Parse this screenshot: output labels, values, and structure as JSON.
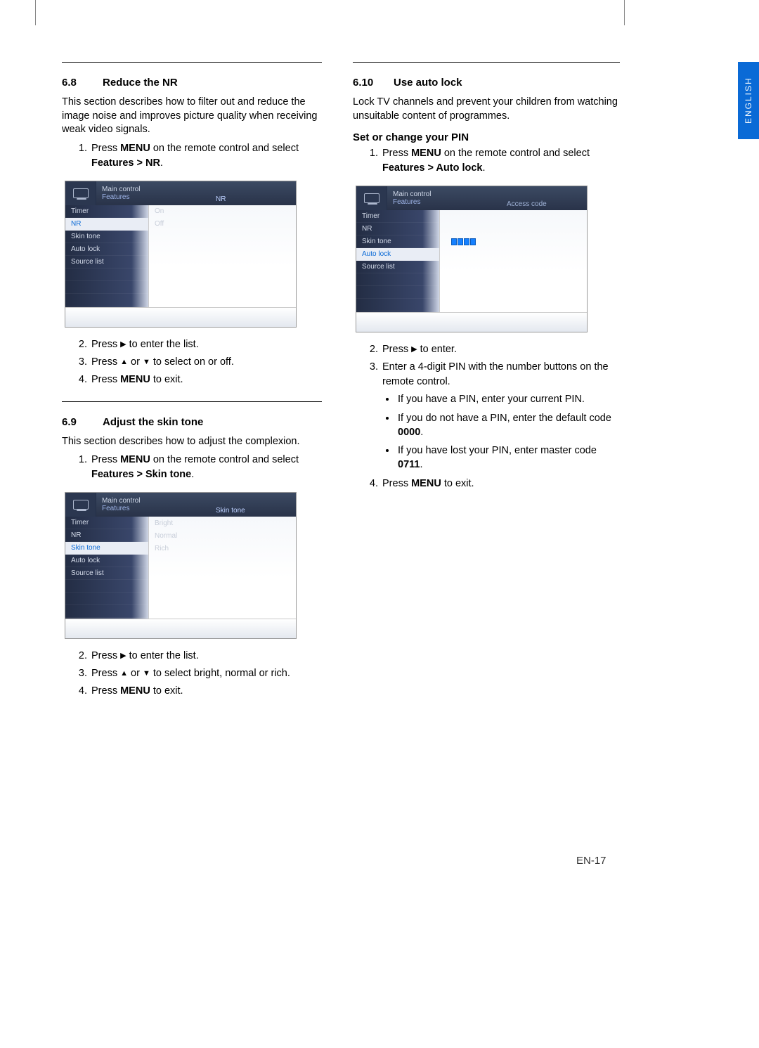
{
  "language_tab": "ENGLISH",
  "page_number": "EN-17",
  "icons": {
    "right": "▶",
    "up": "▲",
    "down": "▼"
  },
  "left": {
    "s68": {
      "num": "6.8",
      "title": "Reduce the NR",
      "intro": "This section describes how to filter out and reduce the image noise and improves picture quality when receiving weak video signals.",
      "step1_a": "Press ",
      "step1_b": "MENU",
      "step1_c": " on the remote control and select ",
      "step1_d": "Features > NR",
      "step1_e": ".",
      "menu": {
        "main": "Main control",
        "features": "Features",
        "right_head": "NR",
        "items": [
          "Timer",
          "NR",
          "Skin tone",
          "Auto lock",
          "Source list"
        ],
        "highlight_index": 1,
        "right_rows": [
          "On",
          "Off"
        ]
      },
      "step2_a": "Press ",
      "step2_b": " to enter the list.",
      "step3_a": "Press ",
      "step3_b": " or ",
      "step3_c": " to select on or off.",
      "step4_a": "Press ",
      "step4_b": "MENU",
      "step4_c": " to exit."
    },
    "s69": {
      "num": "6.9",
      "title": "Adjust the skin tone",
      "intro": "This section describes how to adjust the complexion.",
      "step1_a": "Press ",
      "step1_b": "MENU",
      "step1_c": " on the remote control and select ",
      "step1_d": "Features > Skin tone",
      "step1_e": ".",
      "menu": {
        "main": "Main control",
        "features": "Features",
        "right_head": "Skin tone",
        "items": [
          "Timer",
          "NR",
          "Skin tone",
          "Auto lock",
          "Source list"
        ],
        "highlight_index": 2,
        "right_rows": [
          "Bright",
          "Normal",
          "Rich"
        ]
      },
      "step2_a": "Press ",
      "step2_b": " to enter the list.",
      "step3_a": "Press ",
      "step3_b": " or ",
      "step3_c": " to select bright, normal or rich.",
      "step4_a": "Press ",
      "step4_b": "MENU",
      "step4_c": " to exit."
    }
  },
  "right": {
    "s610": {
      "num": "6.10",
      "title": "Use auto lock",
      "intro": "Lock TV channels and prevent your children from watching unsuitable content of programmes.",
      "sub": "Set or change your PIN",
      "step1_a": "Press ",
      "step1_b": "MENU",
      "step1_c": " on the remote control and select ",
      "step1_d": "Features > Auto lock",
      "step1_e": ".",
      "menu": {
        "main": "Main control",
        "features": "Features",
        "right_head": "Access code",
        "items": [
          "Timer",
          "NR",
          "Skin tone",
          "Auto lock",
          "Source list"
        ],
        "highlight_index": 3
      },
      "step2_a": "Press ",
      "step2_b": " to enter.",
      "step3": "Enter a 4-digit PIN with the number buttons on the remote control.",
      "b1": "If you have a PIN, enter your current PIN.",
      "b2_a": "If you do not have a PIN, enter the default code ",
      "b2_b": "0000",
      "b2_c": ".",
      "b3_a": "If you have lost your PIN, enter master code ",
      "b3_b": "0711",
      "b3_c": ".",
      "step4_a": "Press ",
      "step4_b": "MENU",
      "step4_c": " to exit."
    }
  }
}
